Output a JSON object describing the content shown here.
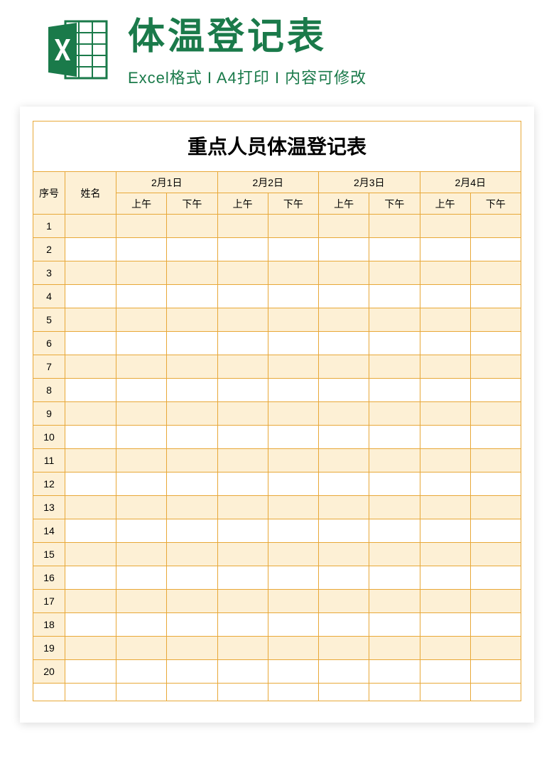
{
  "header": {
    "title": "体温登记表",
    "subtitle": "Excel格式 I A4打印 I 内容可修改"
  },
  "sheet": {
    "title": "重点人员体温登记表",
    "columns": {
      "seq": "序号",
      "name": "姓名",
      "dates": [
        "2月1日",
        "2月2日",
        "2月3日",
        "2月4日"
      ],
      "am": "上午",
      "pm": "下午"
    },
    "rows": [
      {
        "seq": "1"
      },
      {
        "seq": "2"
      },
      {
        "seq": "3"
      },
      {
        "seq": "4"
      },
      {
        "seq": "5"
      },
      {
        "seq": "6"
      },
      {
        "seq": "7"
      },
      {
        "seq": "8"
      },
      {
        "seq": "9"
      },
      {
        "seq": "10"
      },
      {
        "seq": "11"
      },
      {
        "seq": "12"
      },
      {
        "seq": "13"
      },
      {
        "seq": "14"
      },
      {
        "seq": "15"
      },
      {
        "seq": "16"
      },
      {
        "seq": "17"
      },
      {
        "seq": "18"
      },
      {
        "seq": "19"
      },
      {
        "seq": "20"
      }
    ]
  }
}
